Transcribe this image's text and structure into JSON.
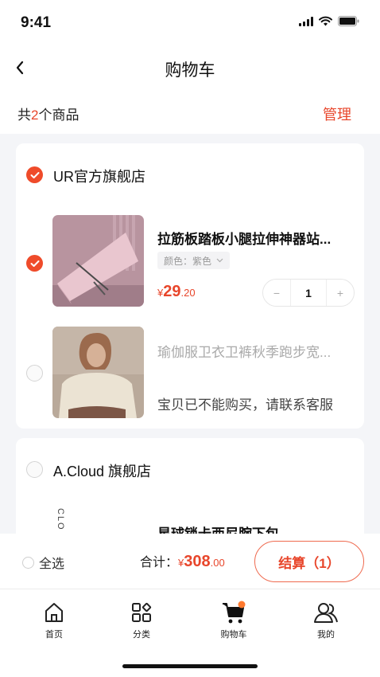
{
  "status": {
    "time": "9:41"
  },
  "nav": {
    "title": "购物车"
  },
  "summary": {
    "prefix": "共",
    "count": "2",
    "suffix": "个商品",
    "manage": "管理"
  },
  "shops": [
    {
      "name": "UR官方旗舰店",
      "checked": true,
      "items": [
        {
          "title": "拉筋板踏板小腿拉伸神器站...",
          "spec": "颜色：紫色",
          "price_symbol": "¥",
          "price_int": "29",
          "price_dec": ".20",
          "quantity": "1",
          "minus": "−",
          "plus": "+",
          "checked": true
        },
        {
          "title": "瑜伽服卫衣卫裤秋季跑步宽...",
          "unavailable_text": "宝贝已不能购买，请联系客服",
          "checked": false
        }
      ]
    },
    {
      "name": "A.Cloud 旗舰店",
      "checked": false,
      "items": [
        {
          "title": "星球锁卡西尼腕下包",
          "thumb_text": "CLO"
        }
      ]
    }
  ],
  "bottom": {
    "select_all": "全选",
    "total_label": "合计：",
    "total_symbol": "¥",
    "total_int": "308",
    "total_dec": ".00",
    "checkout": "结算（1）"
  },
  "tabs": [
    {
      "label": "首页",
      "icon": "home-icon"
    },
    {
      "label": "分类",
      "icon": "category-icon"
    },
    {
      "label": "购物车",
      "icon": "cart-icon",
      "active": true
    },
    {
      "label": "我的",
      "icon": "profile-icon"
    }
  ],
  "colors": {
    "accent": "#e8462b",
    "background": "#f4f5f8",
    "card": "#ffffff"
  }
}
